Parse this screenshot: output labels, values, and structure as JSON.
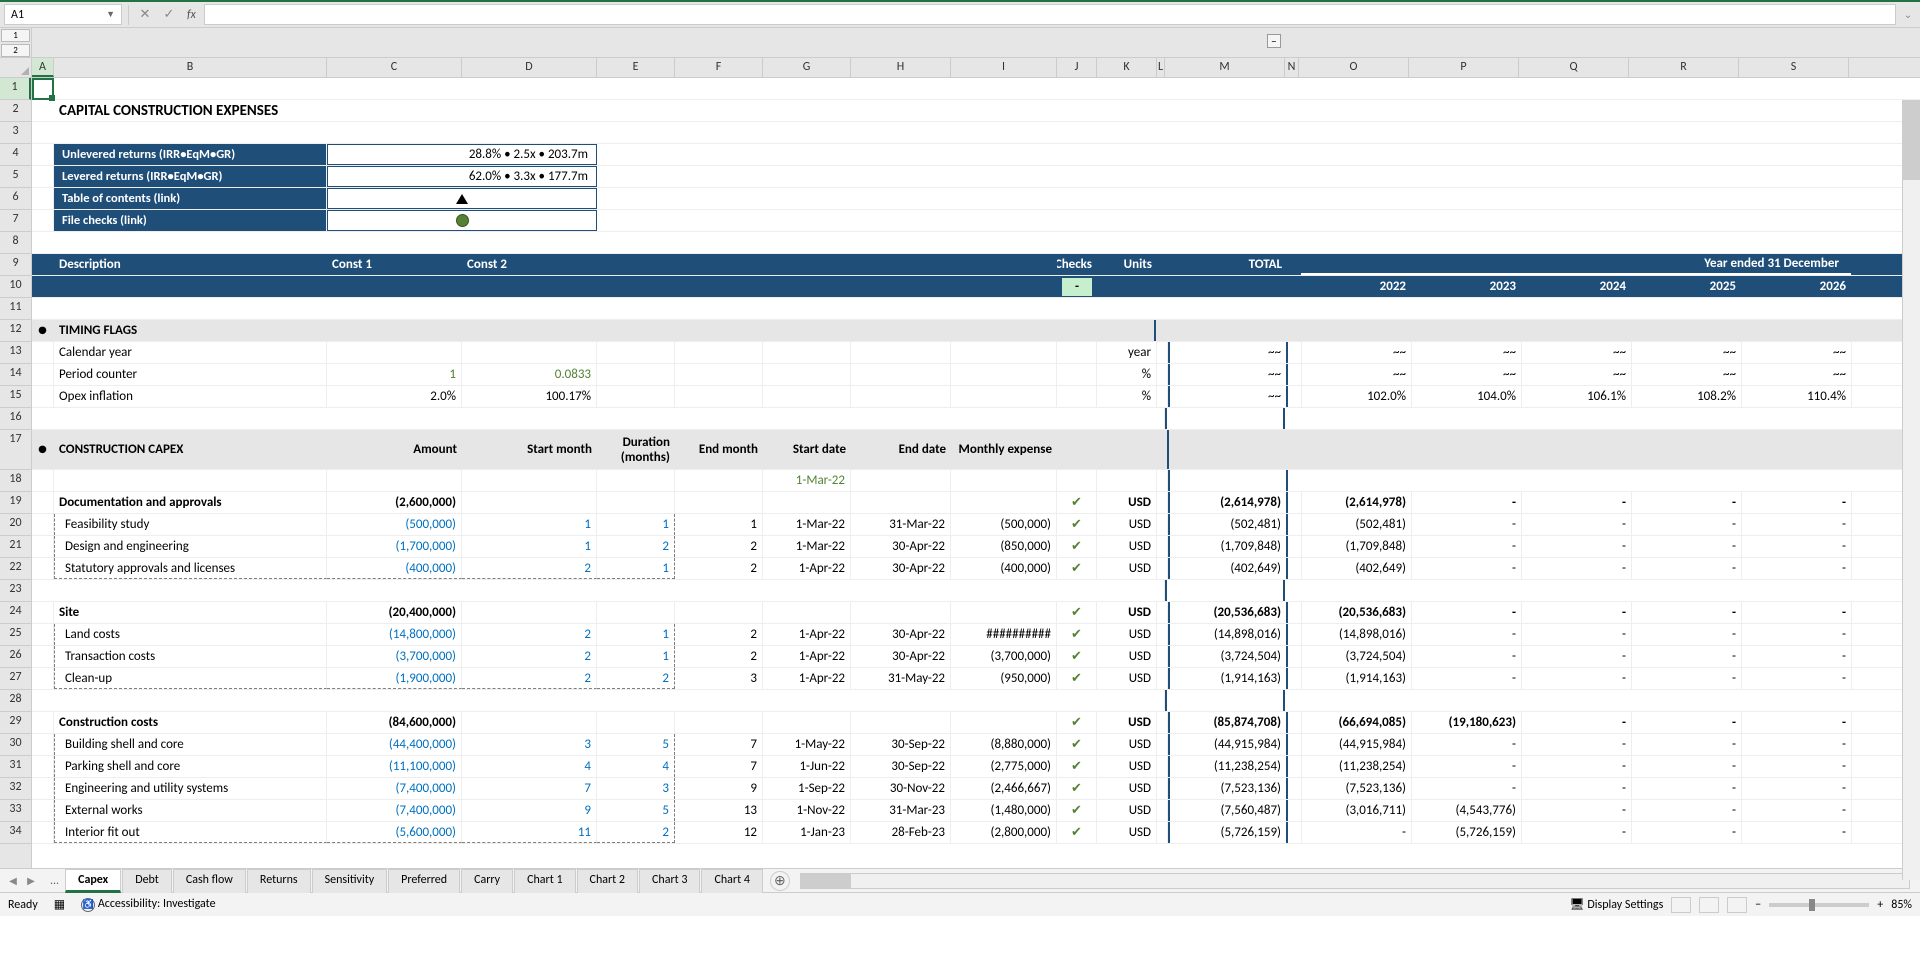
{
  "formula_bar": {
    "name_box": "A1",
    "fx": "fx"
  },
  "outline": {
    "levels": [
      "1",
      "2"
    ],
    "minus": "−"
  },
  "columns": [
    "A",
    "B",
    "C",
    "D",
    "E",
    "F",
    "G",
    "H",
    "I",
    "J",
    "K",
    "L",
    "M",
    "N",
    "O",
    "P",
    "Q",
    "R",
    "S"
  ],
  "row_numbers": [
    "1",
    "2",
    "3",
    "4",
    "5",
    "6",
    "7",
    "8",
    "9",
    "10",
    "11",
    "12",
    "13",
    "14",
    "15",
    "16",
    "17",
    "18",
    "19",
    "20",
    "21",
    "22",
    "23",
    "24",
    "25",
    "26",
    "27",
    "28",
    "29",
    "30",
    "31",
    "32",
    "33",
    "34"
  ],
  "title": "CAPITAL CONSTRUCTION EXPENSES",
  "summary_box": {
    "r1_label": "Unlevered returns (IRR•EqM•GR)",
    "r1_val": "28.8% • 2.5x • 203.7m",
    "r2_label": "Levered returns (IRR•EqM•GR)",
    "r2_val": "62.0% • 3.3x • 177.7m",
    "r3_label": "Table of contents (link)",
    "r4_label": "File checks (link)"
  },
  "headers": {
    "description": "Description",
    "const1": "Const 1",
    "const2": "Const 2",
    "checks": "Checks",
    "checks_val": "-",
    "units": "Units",
    "total": "TOTAL",
    "year_ended": "Year ended 31 December",
    "years": {
      "y2022": "2022",
      "y2023": "2023",
      "y2024": "2024",
      "y2025": "2025",
      "y2026": "2026"
    }
  },
  "sections": {
    "timing": {
      "title": "TIMING FLAGS",
      "rows": [
        {
          "name": "Calendar year",
          "c": "",
          "d": "",
          "unit": "year",
          "total": "~~",
          "y22": "~~",
          "y23": "~~",
          "y24": "~~",
          "y25": "~~",
          "y26": "~~"
        },
        {
          "name": "Period counter",
          "c": "1",
          "d": "0.0833",
          "unit": "%",
          "total": "~~",
          "y22": "~~",
          "y23": "~~",
          "y24": "~~",
          "y25": "~~",
          "y26": "~~"
        },
        {
          "name": "Opex inflation",
          "c": "2.0%",
          "d": "100.17%",
          "unit": "%",
          "total": "~~",
          "y22": "102.0%",
          "y23": "104.0%",
          "y24": "106.1%",
          "y25": "108.2%",
          "y26": "110.4%"
        }
      ]
    },
    "capex": {
      "title": "CONSTRUCTION CAPEX",
      "col_headers": {
        "amount": "Amount",
        "start_month": "Start month",
        "duration": "Duration (months)",
        "end_month": "End month",
        "start_date": "Start date",
        "end_date": "End date",
        "monthly": "Monthly expense"
      },
      "row18_date": "1-Mar-22",
      "groups": [
        {
          "name": "Documentation and approvals",
          "amount": "(2,600,000)",
          "unit": "USD",
          "total": "(2,614,978)",
          "y22": "(2,614,978)",
          "y23": "-",
          "y24": "-",
          "y25": "-",
          "y26": "-",
          "items": [
            {
              "name": "Feasibility study",
              "amount": "(500,000)",
              "sm": "1",
              "dur": "1",
              "em": "1",
              "sd": "1-Mar-22",
              "ed": "31-Mar-22",
              "me": "(500,000)",
              "unit": "USD",
              "total": "(502,481)",
              "y22": "(502,481)",
              "y23": "-",
              "y24": "-",
              "y25": "-",
              "y26": "-"
            },
            {
              "name": "Design and engineering",
              "amount": "(1,700,000)",
              "sm": "1",
              "dur": "2",
              "em": "2",
              "sd": "1-Mar-22",
              "ed": "30-Apr-22",
              "me": "(850,000)",
              "unit": "USD",
              "total": "(1,709,848)",
              "y22": "(1,709,848)",
              "y23": "-",
              "y24": "-",
              "y25": "-",
              "y26": "-"
            },
            {
              "name": "Statutory approvals and licenses",
              "amount": "(400,000)",
              "sm": "2",
              "dur": "1",
              "em": "2",
              "sd": "1-Apr-22",
              "ed": "30-Apr-22",
              "me": "(400,000)",
              "unit": "USD",
              "total": "(402,649)",
              "y22": "(402,649)",
              "y23": "-",
              "y24": "-",
              "y25": "-",
              "y26": "-"
            }
          ]
        },
        {
          "name": "Site",
          "amount": "(20,400,000)",
          "unit": "USD",
          "total": "(20,536,683)",
          "y22": "(20,536,683)",
          "y23": "-",
          "y24": "-",
          "y25": "-",
          "y26": "-",
          "items": [
            {
              "name": "Land costs",
              "amount": "(14,800,000)",
              "sm": "2",
              "dur": "1",
              "em": "2",
              "sd": "1-Apr-22",
              "ed": "30-Apr-22",
              "me": "##########",
              "unit": "USD",
              "total": "(14,898,016)",
              "y22": "(14,898,016)",
              "y23": "-",
              "y24": "-",
              "y25": "-",
              "y26": "-"
            },
            {
              "name": "Transaction costs",
              "amount": "(3,700,000)",
              "sm": "2",
              "dur": "1",
              "em": "2",
              "sd": "1-Apr-22",
              "ed": "30-Apr-22",
              "me": "(3,700,000)",
              "unit": "USD",
              "total": "(3,724,504)",
              "y22": "(3,724,504)",
              "y23": "-",
              "y24": "-",
              "y25": "-",
              "y26": "-"
            },
            {
              "name": "Clean-up",
              "amount": "(1,900,000)",
              "sm": "2",
              "dur": "2",
              "em": "3",
              "sd": "1-Apr-22",
              "ed": "31-May-22",
              "me": "(950,000)",
              "unit": "USD",
              "total": "(1,914,163)",
              "y22": "(1,914,163)",
              "y23": "-",
              "y24": "-",
              "y25": "-",
              "y26": "-"
            }
          ]
        },
        {
          "name": "Construction costs",
          "amount": "(84,600,000)",
          "unit": "USD",
          "total": "(85,874,708)",
          "y22": "(66,694,085)",
          "y23": "(19,180,623)",
          "y24": "-",
          "y25": "-",
          "y26": "-",
          "items": [
            {
              "name": "Building shell and core",
              "amount": "(44,400,000)",
              "sm": "3",
              "dur": "5",
              "em": "7",
              "sd": "1-May-22",
              "ed": "30-Sep-22",
              "me": "(8,880,000)",
              "unit": "USD",
              "total": "(44,915,984)",
              "y22": "(44,915,984)",
              "y23": "-",
              "y24": "-",
              "y25": "-",
              "y26": "-"
            },
            {
              "name": "Parking shell and core",
              "amount": "(11,100,000)",
              "sm": "4",
              "dur": "4",
              "em": "7",
              "sd": "1-Jun-22",
              "ed": "30-Sep-22",
              "me": "(2,775,000)",
              "unit": "USD",
              "total": "(11,238,254)",
              "y22": "(11,238,254)",
              "y23": "-",
              "y24": "-",
              "y25": "-",
              "y26": "-"
            },
            {
              "name": "Engineering and utility systems",
              "amount": "(7,400,000)",
              "sm": "7",
              "dur": "3",
              "em": "9",
              "sd": "1-Sep-22",
              "ed": "30-Nov-22",
              "me": "(2,466,667)",
              "unit": "USD",
              "total": "(7,523,136)",
              "y22": "(7,523,136)",
              "y23": "-",
              "y24": "-",
              "y25": "-",
              "y26": "-"
            },
            {
              "name": "External works",
              "amount": "(7,400,000)",
              "sm": "9",
              "dur": "5",
              "em": "13",
              "sd": "1-Nov-22",
              "ed": "31-Mar-23",
              "me": "(1,480,000)",
              "unit": "USD",
              "total": "(7,560,487)",
              "y22": "(3,016,711)",
              "y23": "(4,543,776)",
              "y24": "-",
              "y25": "-",
              "y26": "-"
            },
            {
              "name": "Interior fit out",
              "amount": "(5,600,000)",
              "sm": "11",
              "dur": "2",
              "em": "12",
              "sd": "1-Jan-23",
              "ed": "28-Feb-23",
              "me": "(2,800,000)",
              "unit": "USD",
              "total": "(5,726,159)",
              "y22": "-",
              "y23": "(5,726,159)",
              "y24": "-",
              "y25": "-",
              "y26": "-"
            }
          ]
        }
      ]
    }
  },
  "sheet_tabs": {
    "ellipsis": "...",
    "active": "Capex",
    "tabs": [
      "Capex",
      "Debt",
      "Cash flow",
      "Returns",
      "Sensitivity",
      "Preferred",
      "Carry",
      "Chart 1",
      "Chart 2",
      "Chart 3",
      "Chart 4"
    ]
  },
  "status_bar": {
    "ready": "Ready",
    "accessibility": "Accessibility: Investigate",
    "display_settings": "Display Settings",
    "zoom": "85%"
  }
}
